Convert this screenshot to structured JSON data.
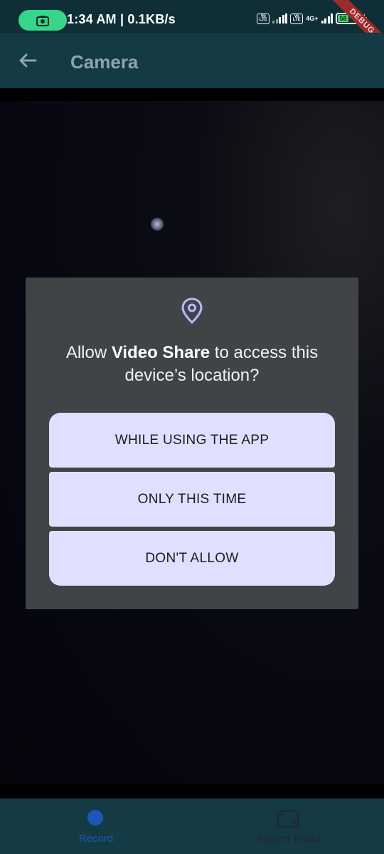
{
  "status_bar": {
    "time_speed": "1:34 AM | 0.1KB/s",
    "lte1": "Vo LTE",
    "lte2": "Vo LTE",
    "network": "4G+",
    "battery": "58",
    "debug": "DEBUG",
    "camera_pill_color": "#36d58a"
  },
  "app_bar": {
    "title": "Camera",
    "back_icon": "arrow-left-icon"
  },
  "dialog": {
    "icon": "location-pin-icon",
    "title_prefix": "Allow ",
    "app_name": "Video Share",
    "title_suffix": " to access this device’s location?",
    "buttons": [
      {
        "label": "WHILE USING THE APP"
      },
      {
        "label": "ONLY THIS TIME"
      },
      {
        "label": "DON'T ALLOW"
      }
    ]
  },
  "bottom_nav": {
    "items": [
      {
        "label": "Record",
        "icon": "record-dot-icon"
      },
      {
        "label": "Aspect Ratio",
        "icon": "aspect-ratio-icon"
      }
    ],
    "active_color": "#1b56b8"
  },
  "colors": {
    "app_bar_bg": "#143a44",
    "dialog_bg": "#414446",
    "button_bg": "#dfe0ff"
  }
}
